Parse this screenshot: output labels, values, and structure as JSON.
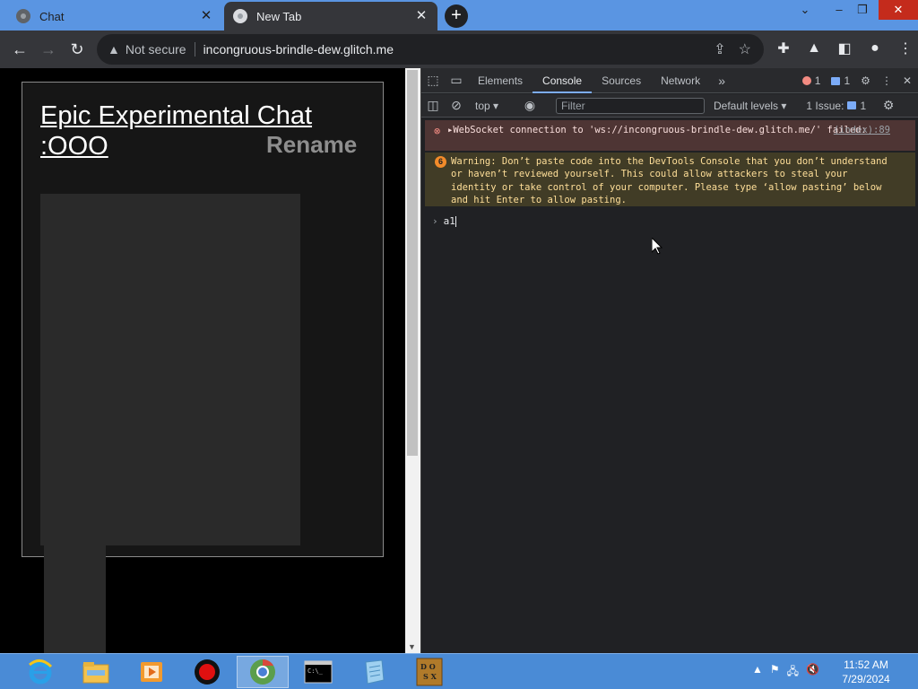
{
  "tabs": [
    {
      "title": "Chat",
      "active": false
    },
    {
      "title": "New Tab",
      "active": true
    }
  ],
  "window_controls": {
    "dropdown": "⌄",
    "minimize": "–",
    "restore": "❐",
    "close": "✕"
  },
  "address_bar": {
    "security_label": "Not secure",
    "url": "incongruous-brindle-dew.glitch.me"
  },
  "page": {
    "chat_title": "Epic Experimental Chat :OOO",
    "rename_label": "Rename"
  },
  "devtools": {
    "tabs": [
      "Elements",
      "Console",
      "Sources",
      "Network"
    ],
    "active_tab": "Console",
    "error_count": "1",
    "message_count": "1",
    "context": "top",
    "filter_placeholder": "Filter",
    "levels_label": "Default levels",
    "issues_label": "1 Issue:",
    "issues_count": "1",
    "messages": {
      "error_text": "▸WebSocket connection to 'ws://incongruous-brindle-dew.glitch.me/' failed:",
      "error_source": "(index):89",
      "warning_count": "6",
      "warning_text": "Warning: Don’t paste code into the DevTools Console that you don’t understand or haven’t reviewed yourself. This could allow attackers to steal your identity or take control of your computer. Please type ‘allow pasting’ below and hit Enter to allow pasting."
    },
    "console_input": "a1"
  },
  "taskbar": {
    "time": "11:52 AM",
    "date": "7/29/2024",
    "apps": [
      "internet-explorer",
      "file-explorer",
      "media-player",
      "record",
      "chrome",
      "command-prompt",
      "notepad",
      "dosbox"
    ]
  },
  "colors": {
    "titlebar": "#5a95e2",
    "toolbar": "#35363a",
    "devtools_bg": "#202124",
    "error_bg": "#4e3534",
    "warning_bg": "#413c26",
    "taskbar": "#4a8bd6"
  }
}
